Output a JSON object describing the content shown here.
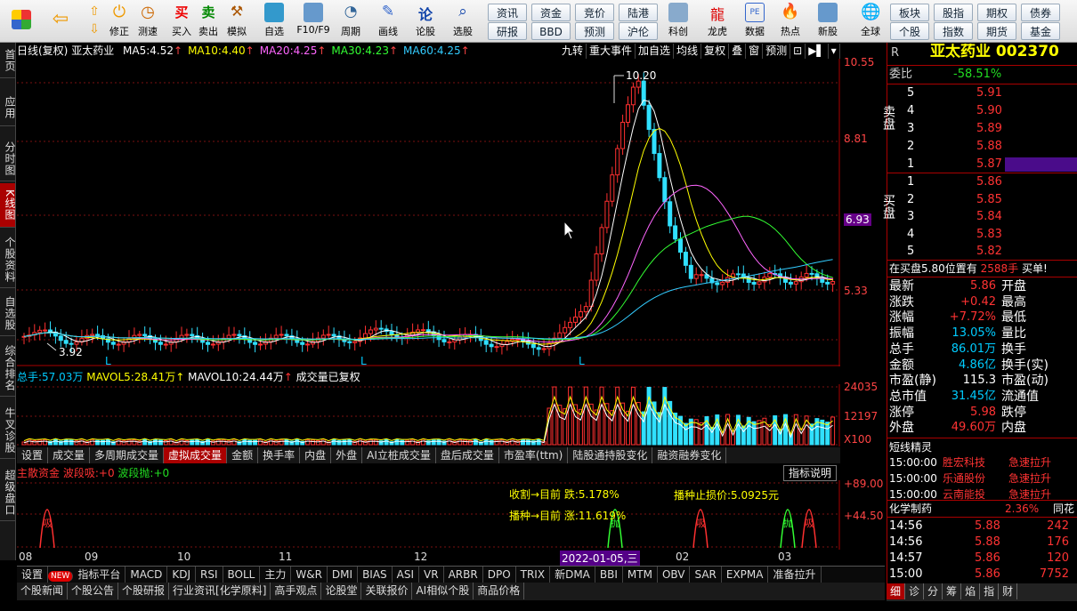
{
  "toolbar": {
    "buttons": [
      "",
      "",
      "修正",
      "测速",
      "买入",
      "卖出",
      "模拟",
      "自选",
      "F10/F9",
      "周期",
      "画线",
      "论股",
      "选股",
      "科创",
      "龙虎",
      "数据",
      "热点",
      "新股",
      "全球"
    ],
    "small": [
      [
        "资讯",
        "资金",
        "竞价",
        "陆港"
      ],
      [
        "研报",
        "BBD",
        "预测",
        "沪伦"
      ]
    ],
    "right_small": [
      [
        "板块",
        "股指",
        "期权",
        "债券"
      ],
      [
        "个股",
        "指数",
        "期货",
        "基金"
      ]
    ]
  },
  "leftnav": [
    "首页",
    "应用",
    "分时图",
    "K线图",
    "个股资料",
    "自选股",
    "综合排名",
    "牛叉诊股",
    "超级盘口"
  ],
  "chart": {
    "period": "日线(复权)",
    "name": "亚太药业",
    "ma": [
      {
        "label": "MA5:",
        "value": "4.52",
        "color": "#ffffff"
      },
      {
        "label": "MA10:",
        "value": "4.40",
        "color": "#ffff00"
      },
      {
        "label": "MA20:",
        "value": "4.25",
        "color": "#ff66ff"
      },
      {
        "label": "MA30:",
        "value": "4.23",
        "color": "#33ff33"
      },
      {
        "label": "MA60:",
        "value": "4.25",
        "color": "#33ccff"
      }
    ],
    "buttons": [
      "九转",
      "重大事件",
      "加自选",
      "均线",
      "复权",
      "叠",
      "窗",
      "预测"
    ],
    "ylabels": [
      "10.55",
      "8.81",
      "6.93",
      "5.33"
    ],
    "high_label": "10.20",
    "low_label": "3.92",
    "L": "L"
  },
  "volume": {
    "total_label": "总手:",
    "total_value": "57.03万",
    "mavol5_label": "MAVOL5:",
    "mavol5_value": "28.41万",
    "mavol10_label": "MAVOL10:",
    "mavol10_value": "24.44万",
    "note": "成交量已复权",
    "ylabels": [
      "24035",
      "12197",
      "X100"
    ]
  },
  "indtabs": [
    "设置",
    "成交量",
    "多周期成交量",
    "虚拟成交量",
    "金额",
    "换手率",
    "内盘",
    "外盘",
    "AI立桩成交量",
    "盘后成交量",
    "市盈率(ttm)",
    "陆股通持股变化",
    "融资融券变化"
  ],
  "indicator": {
    "title": "主散资金",
    "l1": "波段吸:",
    "v1": "+0",
    "l2": "波段抛:",
    "v2": "+0",
    "explain": "指标说明",
    "a1": "收割→目前 跌:5.178%",
    "a2": "播种→目前 涨:11.619%",
    "a3": "播种止损价:5.0925元",
    "ylabels": [
      "+89.00",
      "+44.50"
    ],
    "marks": [
      "吸",
      "抛"
    ]
  },
  "dates": [
    "08",
    "09",
    "10",
    "11",
    "12",
    "2022-01-05,三",
    "02",
    "03"
  ],
  "bottomtabs": [
    "设置",
    "NEW",
    "指标平台",
    "MACD",
    "KDJ",
    "RSI",
    "BOLL",
    "主力",
    "W&R",
    "DMI",
    "BIAS",
    "ASI",
    "VR",
    "ARBR",
    "DPO",
    "TRIX",
    "新DMA",
    "BBI",
    "MTM",
    "OBV",
    "SAR",
    "EXPMA",
    "准备拉升"
  ],
  "newstabs": [
    "个股新闻",
    "个股公告",
    "个股研报",
    "行业资讯[化学原料]",
    "高手观点",
    "论股堂",
    "关联报价",
    "AI相似个股",
    "商品价格"
  ],
  "right": {
    "r": "R",
    "name": "亚太药业 002370",
    "weibi_label": "委比",
    "weibi": "-58.51%",
    "sell": [
      [
        "5",
        "5.91"
      ],
      [
        "4",
        "5.90"
      ],
      [
        "3",
        "5.89"
      ],
      [
        "2",
        "5.88"
      ],
      [
        "1",
        "5.87"
      ]
    ],
    "buy": [
      [
        "1",
        "5.86"
      ],
      [
        "2",
        "5.85"
      ],
      [
        "3",
        "5.84"
      ],
      [
        "4",
        "5.83"
      ],
      [
        "5",
        "5.82"
      ]
    ],
    "sell_side": "卖盘",
    "buy_side": "买盘",
    "notice": "在买盘5.80位置有",
    "notice_qty": "2588手",
    "notice_tail": "买单!",
    "stats": [
      [
        "最新",
        "5.86",
        "开盘"
      ],
      [
        "涨跌",
        "+0.42",
        "最高"
      ],
      [
        "涨幅",
        "+7.72%",
        "最低"
      ],
      [
        "振幅",
        "13.05%",
        "量比"
      ],
      [
        "总手",
        "86.01万",
        "换手"
      ],
      [
        "金额",
        "4.86亿",
        "换手(实)"
      ],
      [
        "市盈(静)",
        "115.3",
        "市盈(动)"
      ],
      [
        "总市值",
        "31.45亿",
        "流通值"
      ],
      [
        "涨停",
        "5.98",
        "跌停"
      ],
      [
        "外盘",
        "49.60万",
        "内盘"
      ]
    ],
    "jingling": "短线精灵",
    "alerts": [
      [
        "15:00:00",
        "胜宏科技",
        "急速拉升"
      ],
      [
        "15:00:00",
        "乐通股份",
        "急速拉升"
      ],
      [
        "15:00:00",
        "云南能投",
        "急速拉升"
      ]
    ],
    "sector": "化学制药",
    "sector_pct": "2.36%",
    "sector_tail": "同花",
    "ticks": [
      [
        "14:56",
        "5.88",
        "242"
      ],
      [
        "14:56",
        "5.88",
        "176"
      ],
      [
        "14:57",
        "5.86",
        "120"
      ],
      [
        "15:00",
        "5.86",
        "7752"
      ]
    ],
    "tabs": [
      "细",
      "诊",
      "分",
      "筹",
      "焰",
      "指",
      "财"
    ]
  }
}
